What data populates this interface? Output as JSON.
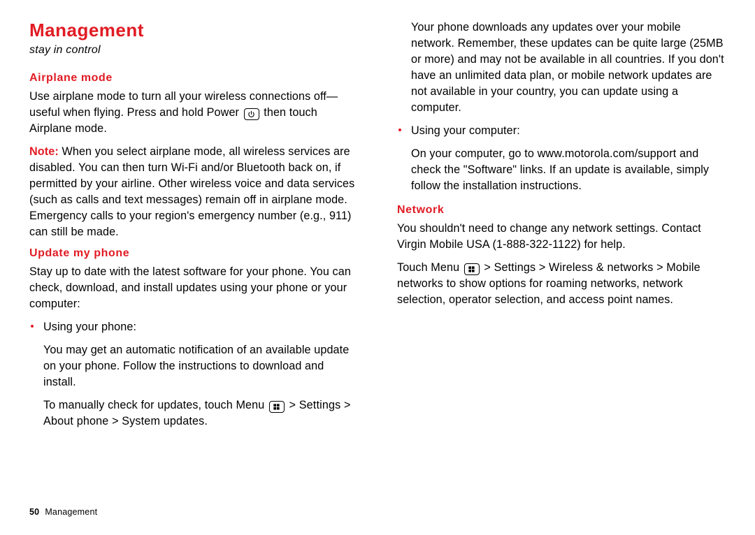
{
  "page": {
    "title": "Management",
    "tagline": "stay in control",
    "footer_page": "50",
    "footer_section": "Management"
  },
  "left": {
    "airplane_h": "Airplane mode",
    "airplane_p1_a": "Use airplane mode to turn all your wireless connections off—useful when flying. Press and hold Power ",
    "airplane_p1_b": " then touch ",
    "airplane_p1_c": "Airplane mode",
    "airplane_p1_d": ".",
    "note_label": "Note:",
    "airplane_p2": " When you select airplane mode, all wireless services are disabled. You can then turn Wi-Fi and/or Bluetooth back on, if permitted by your airline. Other wireless voice and data services (such as calls and text messages) remain off in airplane mode. Emergency calls to your region's emergency number (e.g., 911) can still be made.",
    "update_h": "Update my phone",
    "update_p1": "Stay up to date with the latest software for your phone. You can check, download, and install updates using your phone or your computer:",
    "li_phone_label": "Using your phone:",
    "li_phone_p1": "You may get an automatic notification of an available update on your phone. Follow the instructions to download and install.",
    "li_phone_p2_a": "To manually check for updates, touch Menu ",
    "li_phone_p2_b": " > ",
    "path_settings": "Settings",
    "path_about": "About phone",
    "path_system_updates": "System updates",
    "gt": " > "
  },
  "right": {
    "cont_p": "Your phone downloads any updates over your mobile network. Remember, these updates can be quite large (25MB or more) and may not be available in all countries. If you don't have an unlimited data plan, or mobile network updates are not available in your country, you can update using a computer.",
    "li_computer_label": "Using your computer:",
    "li_computer_p_a": "On your computer, go to ",
    "support_url": "www.motorola.com/support",
    "li_computer_p_b": " and check the \"Software\" links. If an update is available, simply follow the installation instructions.",
    "network_h": "Network",
    "network_p1": "You shouldn't need to change any network settings. Contact Virgin Mobile USA (1-888-322-1122) for help.",
    "network_p2_a": "Touch Menu ",
    "network_p2_b": " > ",
    "path_wireless": "Wireless & networks",
    "path_mobile_networks": "Mobile networks",
    "network_p2_c": " to show options for roaming networks, network selection, operator selection, and access point names."
  },
  "icons": {
    "power": "power-icon",
    "menu": "menu-icon"
  }
}
